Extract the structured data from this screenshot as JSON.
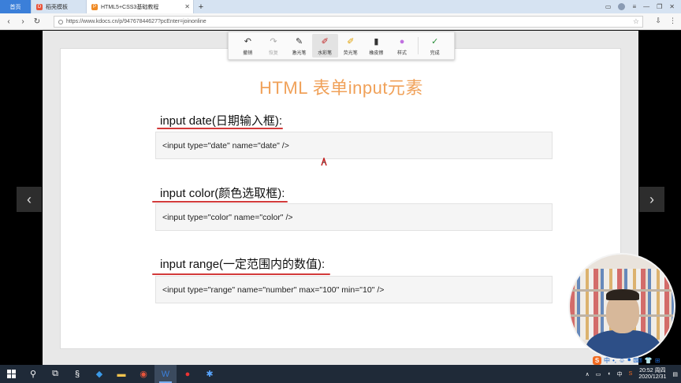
{
  "browser": {
    "tabs": [
      {
        "label": "首页",
        "active": false
      },
      {
        "label": "稻壳模板",
        "active": false
      },
      {
        "label": "HTML5+CSS3基础教程",
        "active": true
      }
    ],
    "new_tab": "+",
    "url": "https://www.kdocs.cn/p/94767844627?pcEnter=joinonline"
  },
  "toolbar": {
    "tools": [
      {
        "label": "撤销",
        "icon": "undo-icon",
        "glyph": "↶"
      },
      {
        "label": "恢复",
        "icon": "redo-icon",
        "glyph": "↷"
      },
      {
        "label": "激光笔",
        "icon": "laser-pen-icon",
        "glyph": "✎"
      },
      {
        "label": "水彩笔",
        "icon": "watercolor-pen-icon",
        "glyph": "✐"
      },
      {
        "label": "荧光笔",
        "icon": "highlighter-icon",
        "glyph": "✐"
      },
      {
        "label": "橡皮擦",
        "icon": "eraser-icon",
        "glyph": "▮"
      },
      {
        "label": "样式",
        "icon": "style-color-icon",
        "glyph": "●"
      },
      {
        "label": "完成",
        "icon": "check-icon",
        "glyph": "✓"
      }
    ]
  },
  "slide": {
    "title": "HTML 表单input元素",
    "sections": [
      {
        "label": "input date(日期输入框):",
        "code": "<input type=\"date\" name=\"date\" />"
      },
      {
        "label": "input color(颜色选取框):",
        "code": "<input type=\"color\" name=\"color\" />"
      },
      {
        "label": "input range(一定范围内的数值):",
        "code": "<input type=\"range\" name=\"number\" max=\"100\" min=\"10\" />"
      }
    ],
    "prev": "‹",
    "next": "›"
  },
  "ime": {
    "logo": "S",
    "mode": "中"
  },
  "taskbar": {
    "tray_lang": "中",
    "time": "20:52 周四",
    "date": "2020/12/31"
  },
  "colors": {
    "title": "#f0a159",
    "underline": "#d23a3a",
    "taskbar": "#1f2a38",
    "active_tab_home": "#3b7fd9"
  }
}
